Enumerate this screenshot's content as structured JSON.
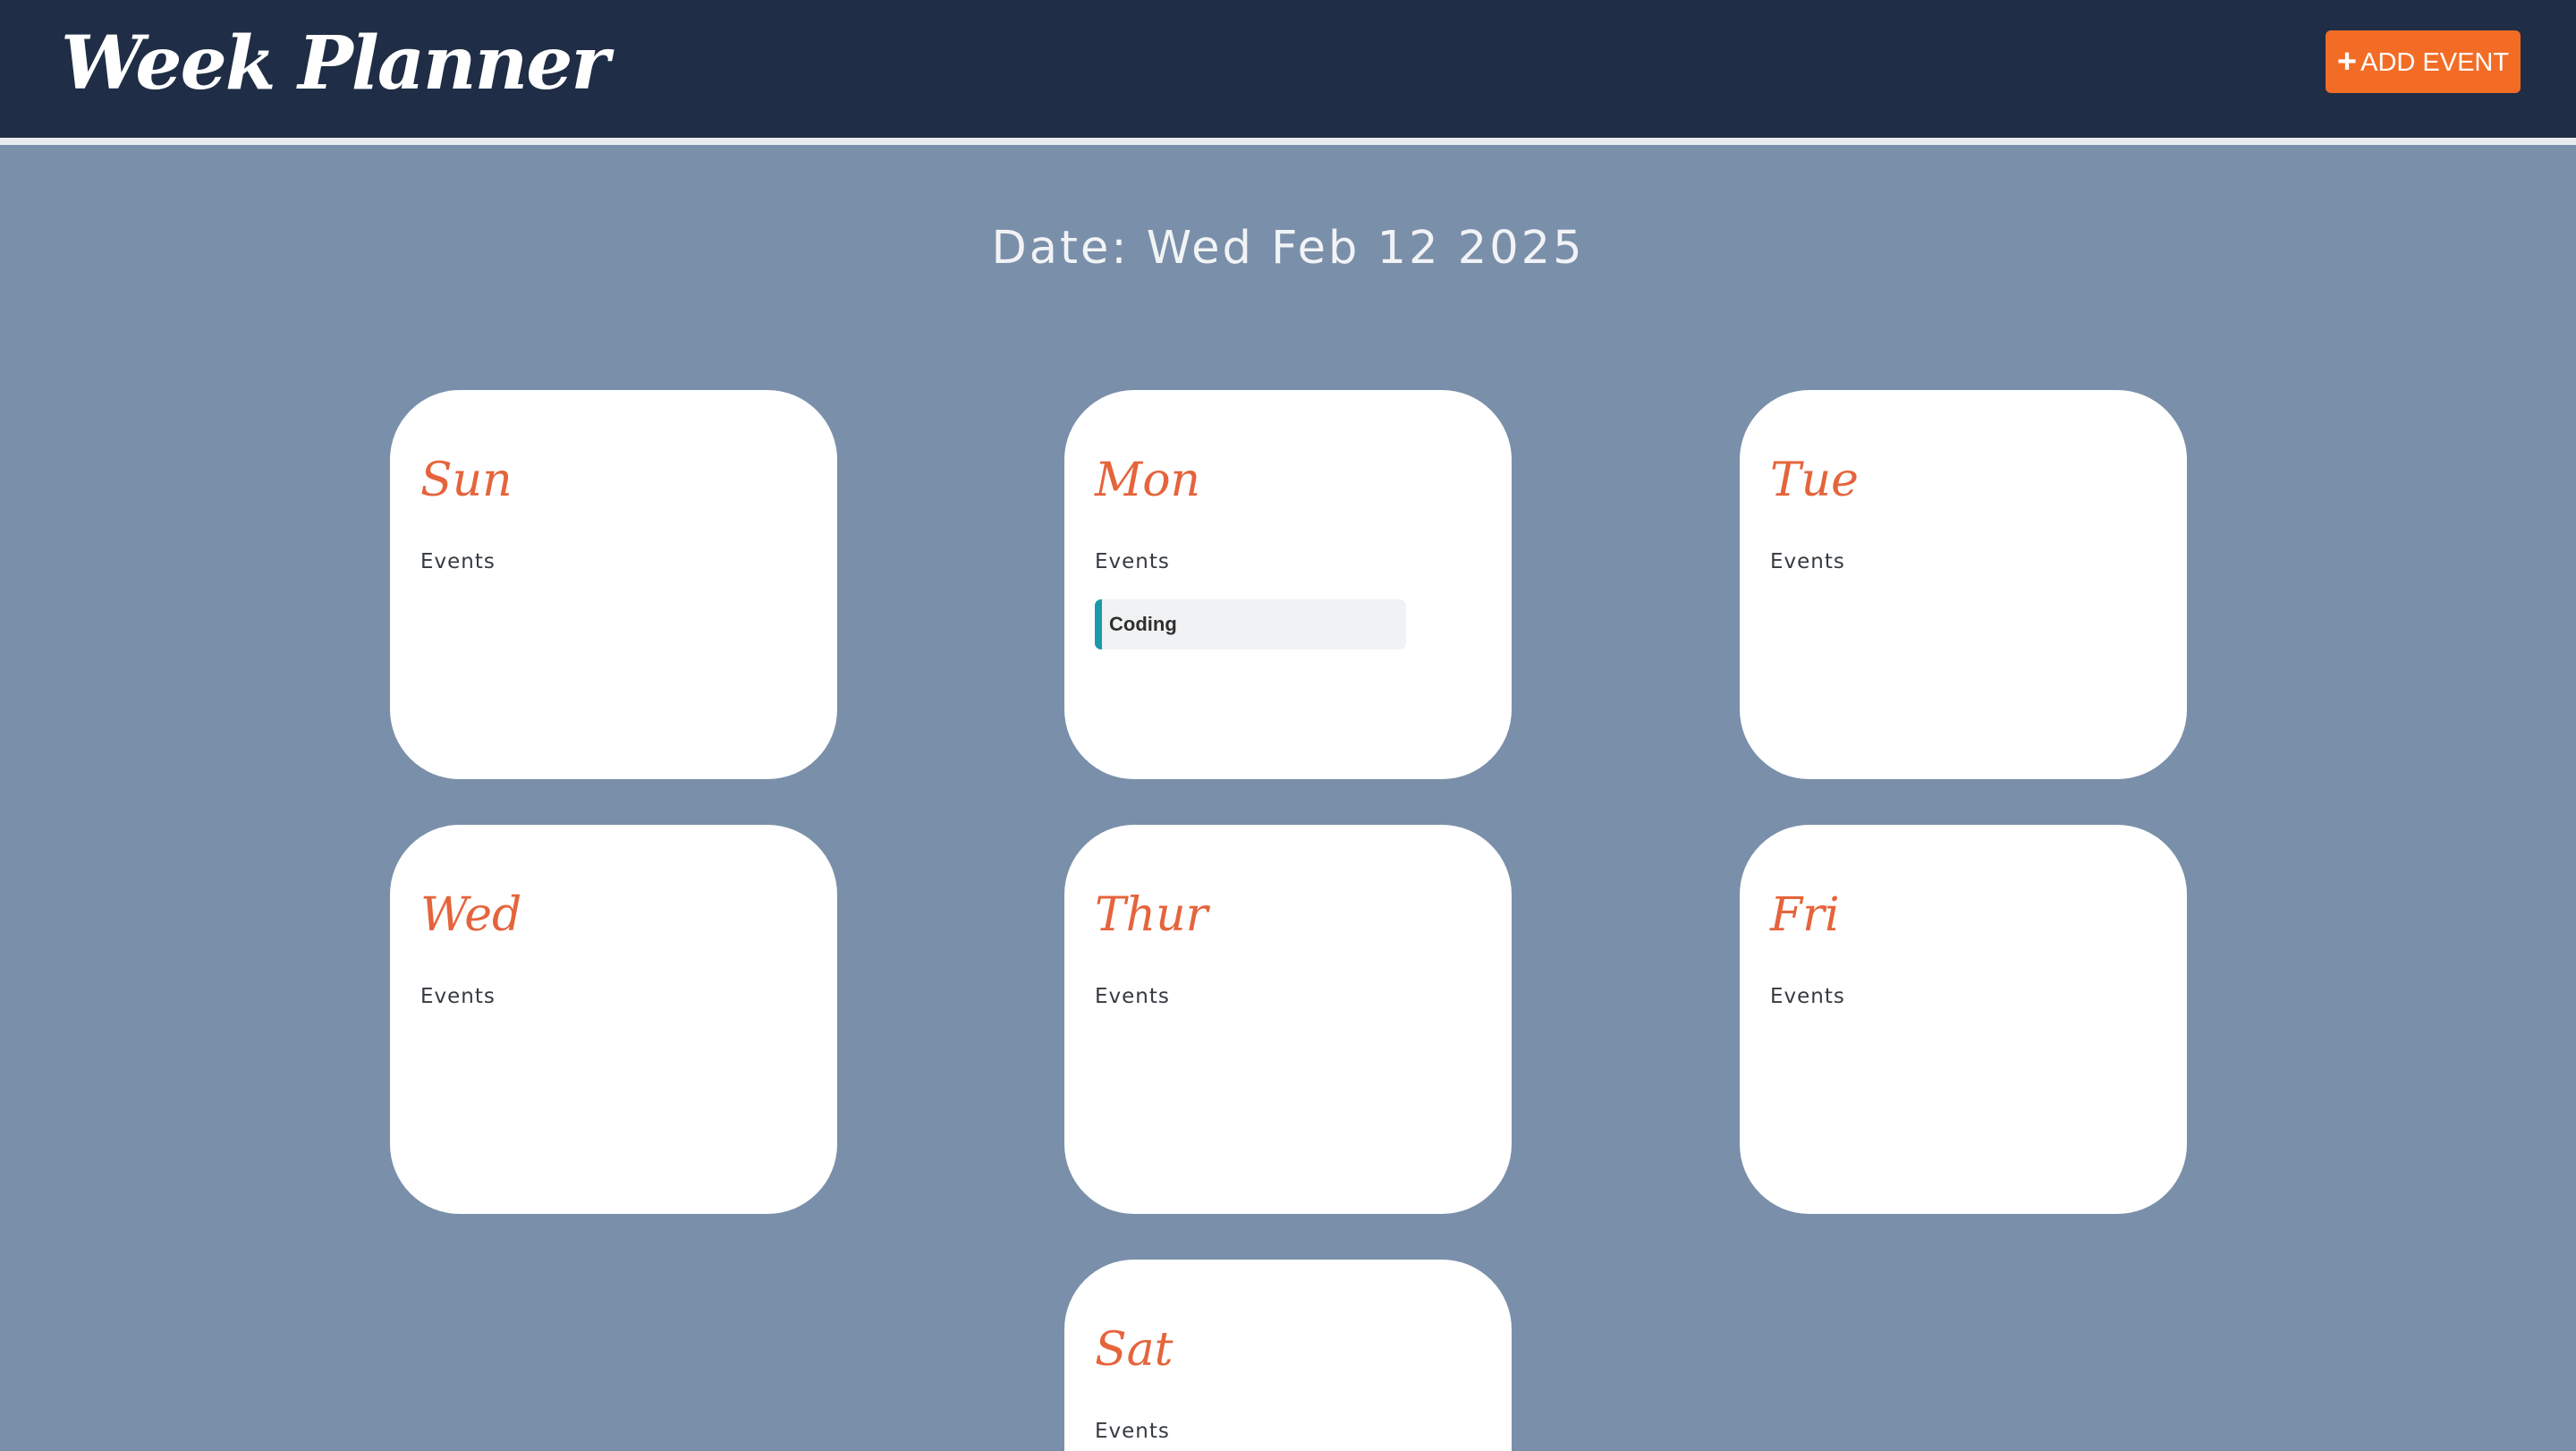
{
  "header": {
    "title": "Week Planner",
    "add_button_label": "ADD EVENT",
    "add_button_icon": "plus-icon",
    "background_color": "#1f2e46",
    "button_color": "#f36c25"
  },
  "main": {
    "date_text": "Date: Wed Feb 12 2025",
    "background_color": "#7a8fa9",
    "days": [
      {
        "name": "Sun",
        "events_label": "Events",
        "events": []
      },
      {
        "name": "Mon",
        "events_label": "Events",
        "events": [
          {
            "title": "Coding",
            "accent_color": "#1b9aaa"
          }
        ]
      },
      {
        "name": "Tue",
        "events_label": "Events",
        "events": []
      },
      {
        "name": "Wed",
        "events_label": "Events",
        "events": []
      },
      {
        "name": "Thur",
        "events_label": "Events",
        "events": []
      },
      {
        "name": "Fri",
        "events_label": "Events",
        "events": []
      },
      {
        "name": "Sat",
        "events_label": "Events",
        "events": []
      }
    ]
  }
}
